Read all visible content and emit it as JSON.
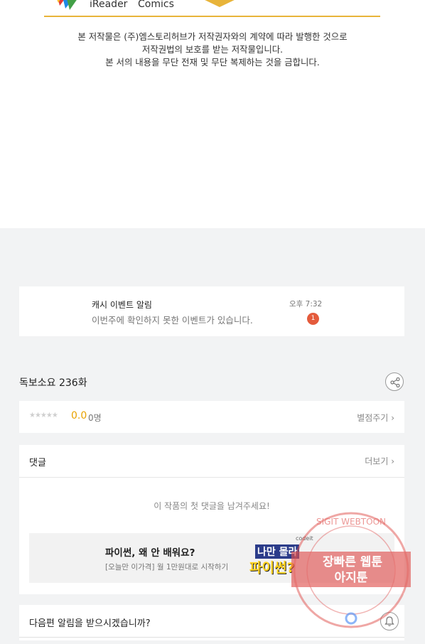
{
  "logos": {
    "ireader": "iReader",
    "comics": "Comics",
    "brand_color": "#e8b43a"
  },
  "copyright": {
    "line1": "본 저작물은 (주)엠스토리허브가 저작권자와의 계약에 따라 발행한 것으로",
    "line2": "저작권법의 보호를 받는 저작물입니다.",
    "line3": "본 서의 내용을 무단 전재 및 무단 복제하는 것을 금합니다."
  },
  "notification": {
    "title": "캐시 이벤트 알림",
    "message": "이번주에 확인하지 못한 이벤트가 있습니다.",
    "time": "오후 7:32",
    "badge": "1",
    "badge_color": "#e45b3c"
  },
  "episode": {
    "title": "독보소요 236화",
    "share_icon": "share-icon"
  },
  "rating": {
    "stars": "★★★★★",
    "score": "0.0",
    "count": "0명",
    "rate_label": "별점주기",
    "score_color": "#e8a200"
  },
  "comments": {
    "title": "댓글",
    "more_label": "더보기",
    "empty_message": "이 작품의 첫 댓글을 남겨주세요!"
  },
  "ad": {
    "title": "파이썬, 왜 안 배워요?",
    "subtitle": "[오늘만 이가격] 월 1만원대로 시작하기",
    "code_label": "codeit",
    "graphic_line1": "나만 몰라",
    "graphic_line2": "파이썬?"
  },
  "subscribe": {
    "question": "다음편 알림을 받으시겠습니까?",
    "bell_icon": "bell-icon"
  },
  "watermark": {
    "ring_text": "SIGIT WEBTOON",
    "line1": "장빠른 웹툰",
    "line2": "아지툰",
    "color": "#e0524f"
  }
}
